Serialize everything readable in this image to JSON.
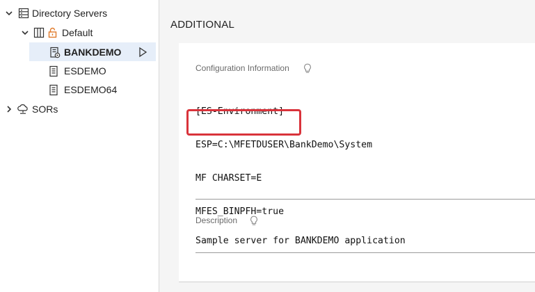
{
  "tree": {
    "directory_servers": "Directory Servers",
    "default": "Default",
    "bankdemo": "BANKDEMO",
    "esdemo": "ESDEMO",
    "esdemo64": "ESDEMO64",
    "sors": "SORs"
  },
  "section": {
    "title": "ADDITIONAL"
  },
  "config": {
    "label": "Configuration Information",
    "lines": [
      "[ES-Environment]",
      "ESP=C:\\MFETDUSER\\BankDemo\\System",
      "MF_CHARSET=E",
      "MFES_BINPFH=true"
    ]
  },
  "description": {
    "label": "Description",
    "value": "Sample server for BANKDEMO application"
  },
  "colors": {
    "selected_bg": "#e6eef9",
    "highlight": "#d9333b",
    "lock_icon": "#e07a2a"
  }
}
